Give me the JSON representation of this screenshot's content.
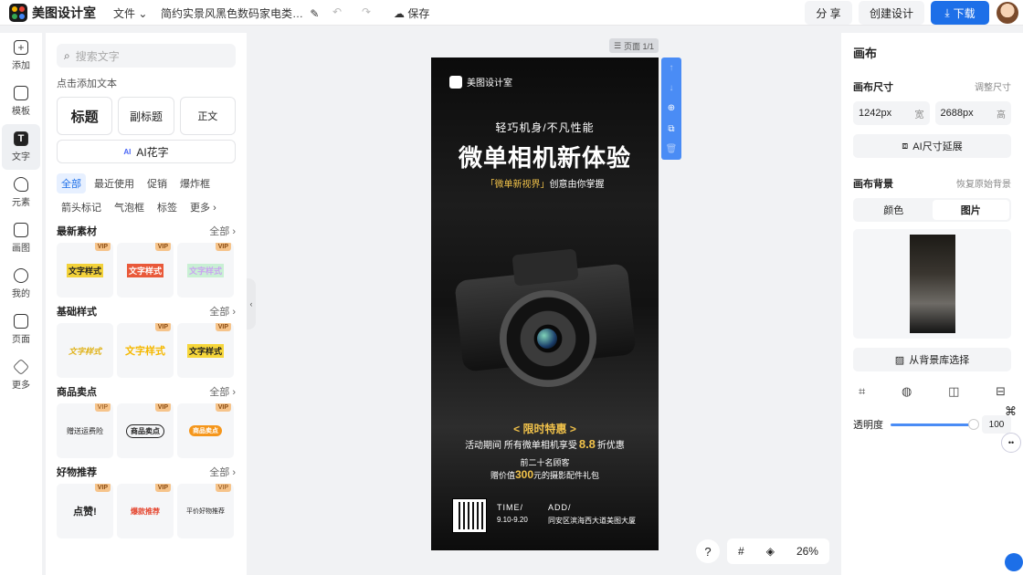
{
  "app": {
    "name": "美图设计室"
  },
  "topbar": {
    "file_label": "文件",
    "doc_title": "简约实景风黑色数码家电类…",
    "save_label": "保存",
    "share_label": "分 享",
    "create_label": "创建设计",
    "download_label": "下载"
  },
  "rail": {
    "items": [
      {
        "label": "添加",
        "icon": "plus-icon"
      },
      {
        "label": "模板",
        "icon": "template-icon"
      },
      {
        "label": "文字",
        "icon": "text-icon"
      },
      {
        "label": "元素",
        "icon": "shapes-icon"
      },
      {
        "label": "画图",
        "icon": "edit-icon"
      },
      {
        "label": "我的",
        "icon": "user-icon"
      },
      {
        "label": "页面",
        "icon": "page-icon"
      },
      {
        "label": "更多",
        "icon": "cube-icon"
      }
    ]
  },
  "panel": {
    "search_placeholder": "搜索文字",
    "hint": "点击添加文本",
    "title_btn": "标题",
    "subtitle_btn": "副标题",
    "body_btn": "正文",
    "ai_btn": "AI花字",
    "ai_tag": "AI",
    "filters": [
      "全部",
      "最近使用",
      "促销",
      "爆炸框",
      "箭头标记",
      "气泡框",
      "标签",
      "更多"
    ],
    "all_label": "全部",
    "vip": "VIP",
    "sections": [
      {
        "title": "最新素材",
        "cards": [
          "文字样式",
          "文字样式",
          "文字样式"
        ]
      },
      {
        "title": "基础样式",
        "cards": [
          "文字样式",
          "文字样式",
          "文字样式"
        ]
      },
      {
        "title": "商品卖点",
        "cards": [
          "赠送运费险",
          "商品卖点",
          "商品卖点"
        ]
      },
      {
        "title": "好物推荐",
        "cards": [
          "点赞!",
          "爆款推荐",
          "平价好物推荐"
        ]
      }
    ]
  },
  "canvas": {
    "page_label": "页面 1/1",
    "zoom": "26%",
    "help": "?"
  },
  "poster": {
    "brand": "美图设计室",
    "tagline": "轻巧机身/不凡性能",
    "headline": "微单相机新体验",
    "sub_highlight": "「微单新视界」",
    "sub_rest": "创意由你掌握",
    "promo_title": "< 限时特惠 >",
    "promo_line1_a": "活动期间 所有微单相机享受",
    "promo_line1_num": "8.8",
    "promo_line1_b": "折优惠",
    "promo_line2": "前二十名顾客",
    "promo_line3_a": "赠价值",
    "promo_line3_num": "300",
    "promo_line3_b": "元的摄影配件礼包",
    "time_label": "TIME/",
    "time_value": "9.10-9.20",
    "add_label": "ADD/",
    "add_value": "同安区滨海西大道美图大厦"
  },
  "right": {
    "title": "画布",
    "size_label": "画布尺寸",
    "adjust_label": "调整尺寸",
    "width_value": "1242px",
    "width_unit": "宽",
    "height_value": "2688px",
    "height_unit": "高",
    "ai_extend": "AI尺寸延展",
    "bg_label": "画布背景",
    "restore_label": "恢复原始背景",
    "tab_color": "颜色",
    "tab_image": "图片",
    "library_btn": "从背景库选择",
    "opacity_label": "透明度",
    "opacity_value": "100"
  }
}
